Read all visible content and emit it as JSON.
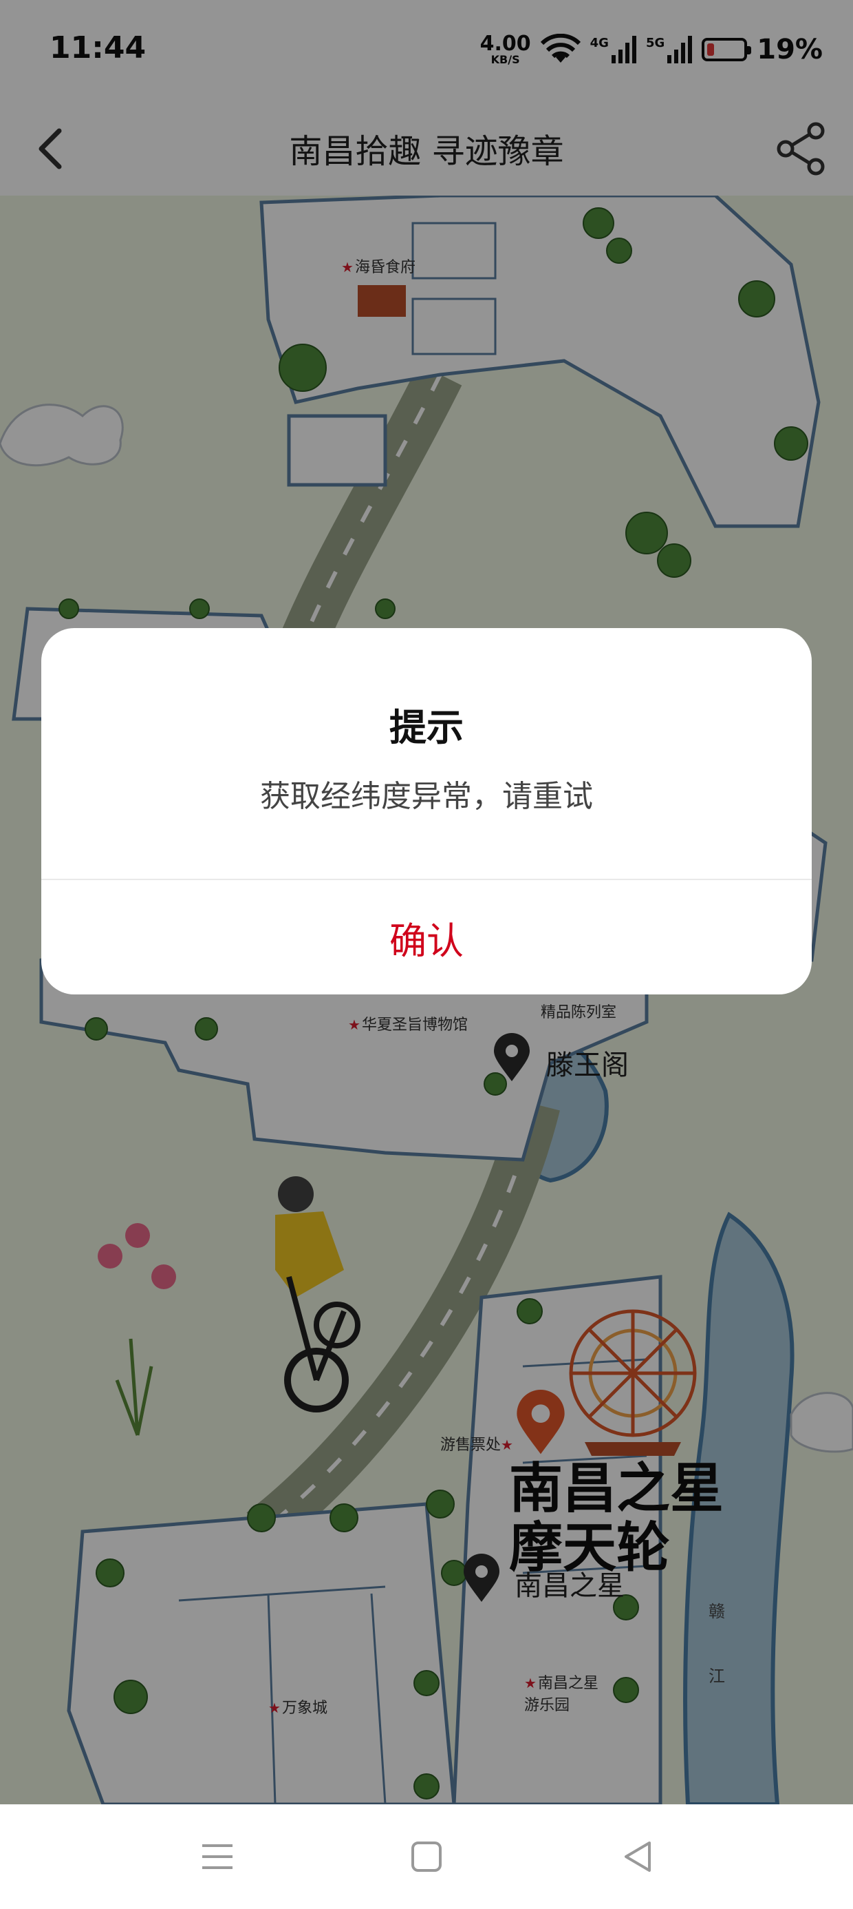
{
  "status_bar": {
    "time": "11:44",
    "speed_value": "4.00",
    "speed_unit": "KB/S",
    "net_4g": "4G",
    "net_5g": "5G",
    "battery_percent": "19%",
    "battery_level": 0.19,
    "battery_color": "#e23a3a"
  },
  "header": {
    "title": "南昌拾趣 寻迹豫章",
    "back_icon": "chevron-left-icon",
    "share_icon": "share-icon"
  },
  "map": {
    "pois": [
      {
        "name": "海昏食府"
      },
      {
        "name": "华夏圣旨博物馆"
      },
      {
        "name": "精品陈列室"
      },
      {
        "name": "游售票处"
      },
      {
        "name": "南昌之星游乐园"
      },
      {
        "name": "万象城"
      }
    ],
    "pins": [
      {
        "label": "滕王阁",
        "color": "#2b2b2b"
      },
      {
        "label": "南昌之星",
        "color": "#2b2b2b"
      },
      {
        "label": "",
        "color": "#e2572a"
      }
    ],
    "landmark_line1": "南昌之星",
    "landmark_line2": "摩天轮",
    "river_char1": "赣",
    "river_char2": "江"
  },
  "dialog": {
    "title": "提示",
    "message": "获取经纬度异常，请重试",
    "confirm_label": "确认",
    "accent_color": "#d0021b"
  },
  "nav": {
    "menu_icon": "menu-icon",
    "home_icon": "square-home-icon",
    "back_icon": "triangle-back-icon"
  }
}
